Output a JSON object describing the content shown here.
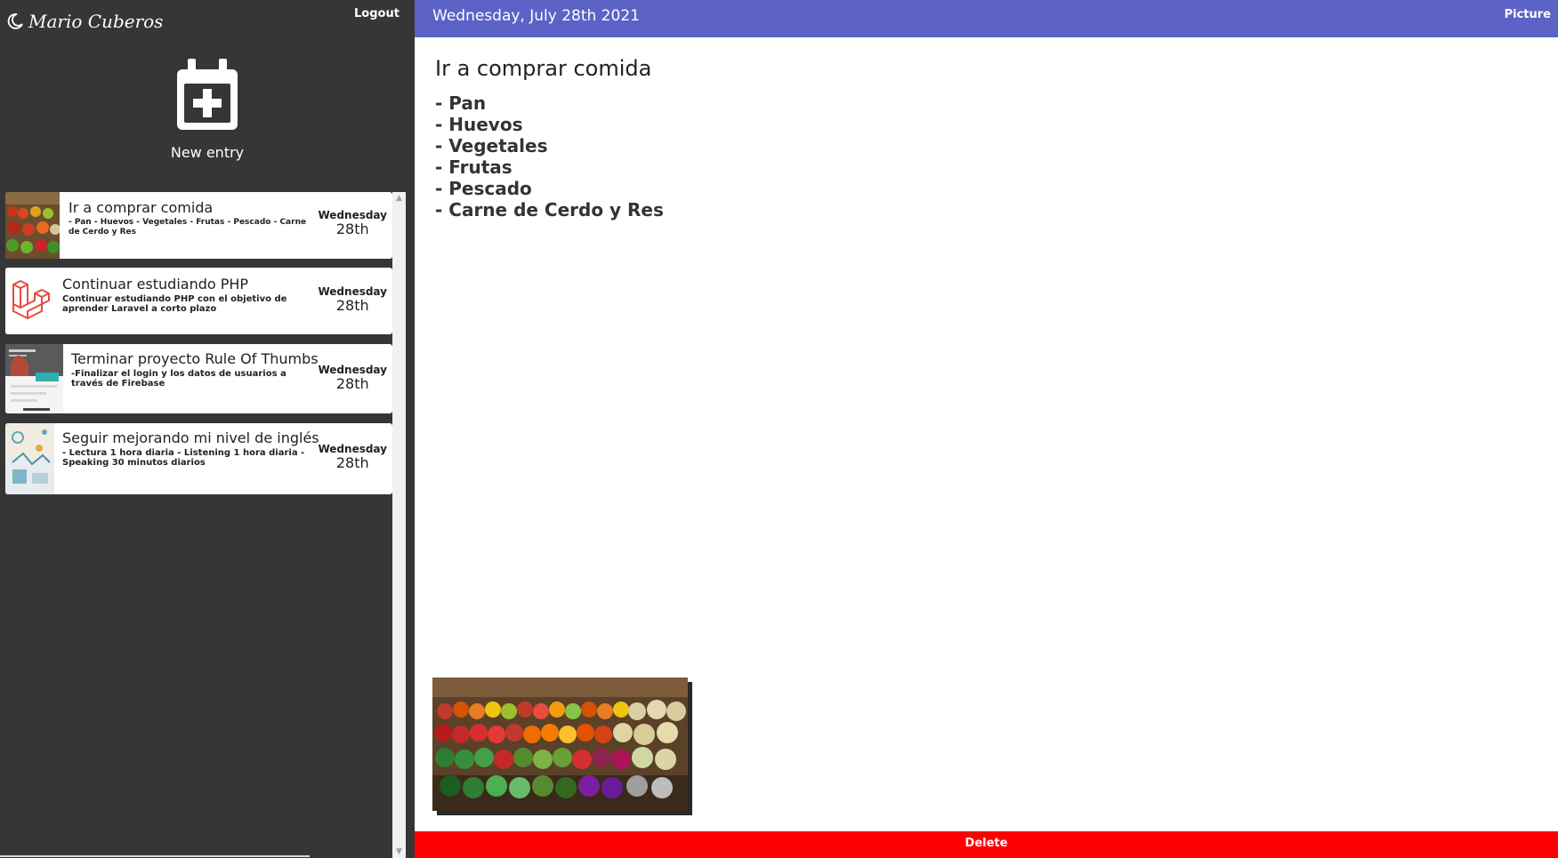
{
  "user": {
    "name": "Mario Cuberos"
  },
  "logout_label": "Logout",
  "new_entry_label": "New entry",
  "entries": [
    {
      "title": "Ir a comprar comida",
      "description": "- Pan - Huevos - Vegetales - Frutas - Pescado - Carne de Cerdo y Res",
      "day": "Wednesday",
      "date": "28th",
      "thumbnail": "produce-stand-photo"
    },
    {
      "title": "Continuar estudiando PHP",
      "description": "Continuar estudiando PHP con el objetivo de aprender Laravel a corto plazo",
      "day": "Wednesday",
      "date": "28th",
      "thumbnail": "laravel-logo"
    },
    {
      "title": "Terminar proyecto Rule Of Thumbs",
      "description": "-Finalizar el login y los datos de usuarios a través de Firebase",
      "day": "Wednesday",
      "date": "28th",
      "thumbnail": "website-screenshot"
    },
    {
      "title": "Seguir mejorando mi nivel de inglés",
      "description": "- Lectura 1 hora diaria - Listening 1 hora diaria - Speaking 30 minutos diarios",
      "day": "Wednesday",
      "date": "28th",
      "thumbnail": "tech-illustration"
    }
  ],
  "header": {
    "date_title": "Wednesday, July 28th 2021",
    "picture_label": "Picture"
  },
  "note": {
    "title": "Ir a comprar comida",
    "items": [
      "- Pan",
      "- Huevos",
      "- Vegetales",
      "- Frutas",
      "- Pescado",
      "- Carne de Cerdo y Res"
    ]
  },
  "delete_label": "Delete",
  "colors": {
    "sidebar": "#363636",
    "topbar": "#5c62c6",
    "delete": "#ff0000",
    "laravel": "#e74c3c"
  }
}
